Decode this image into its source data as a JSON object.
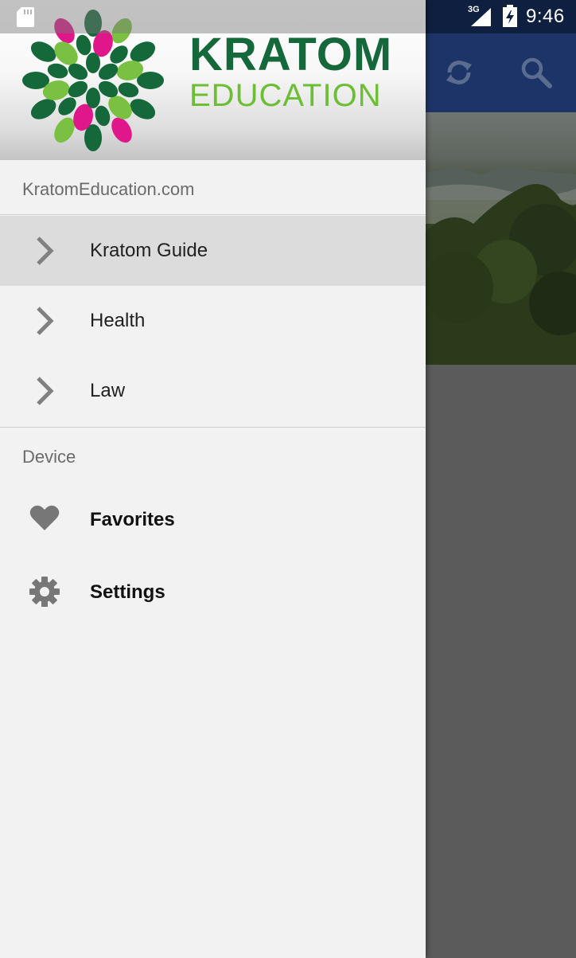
{
  "status_bar": {
    "time": "9:46",
    "network": "3G",
    "icons": [
      "sd-card-icon",
      "signal-icon",
      "battery-charging-icon"
    ]
  },
  "toolbar": {
    "icons": [
      "sync-icon",
      "search-icon"
    ]
  },
  "drawer": {
    "logo": {
      "line1": "KRATOM",
      "line2": "EDUCATION"
    },
    "site_section": {
      "title": "KratomEducation.com",
      "items": [
        {
          "label": "Kratom Guide",
          "icon": "chevron-right-icon",
          "selected": true
        },
        {
          "label": "Health",
          "icon": "chevron-right-icon",
          "selected": false
        },
        {
          "label": "Law",
          "icon": "chevron-right-icon",
          "selected": false
        }
      ]
    },
    "device_section": {
      "title": "Device",
      "items": [
        {
          "label": "Favorites",
          "icon": "heart-icon"
        },
        {
          "label": "Settings",
          "icon": "gear-icon"
        }
      ]
    }
  },
  "colors": {
    "toolbar": "#1d3468",
    "status_bar": "#0e1f40",
    "logo_dark_green": "#14683a",
    "logo_light_green": "#6cbf34",
    "logo_pink": "#e0178a",
    "selected_row": "#dcdcdc",
    "drawer_background": "#f2f2f2"
  }
}
